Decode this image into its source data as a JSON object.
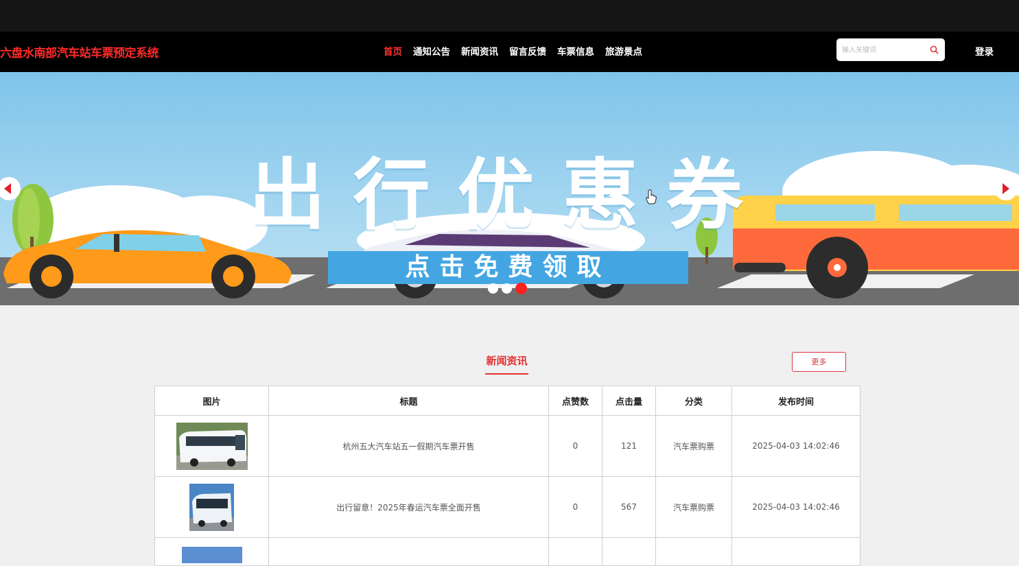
{
  "header": {
    "brand": "六盘水南部汽车站车票预定系统",
    "nav": [
      {
        "label": "首页",
        "active": true
      },
      {
        "label": "通知公告",
        "active": false
      },
      {
        "label": "新闻资讯",
        "active": false
      },
      {
        "label": "留言反馈",
        "active": false
      },
      {
        "label": "车票信息",
        "active": false
      },
      {
        "label": "旅游景点",
        "active": false
      }
    ],
    "search_placeholder": "输入关键词",
    "login_label": "登录"
  },
  "banner": {
    "title": "出行优惠券",
    "cta": "点击免费领取",
    "slide_count": 3,
    "active_slide": 3
  },
  "news": {
    "section_title": "新闻资讯",
    "more_label": "更多",
    "columns": [
      "图片",
      "标题",
      "点赞数",
      "点击量",
      "分类",
      "发布时间"
    ],
    "rows": [
      {
        "title": "杭州五大汽车站五一假期汽车票开售",
        "likes": "0",
        "clicks": "121",
        "category": "汽车票购票",
        "date": "2025-04-03 14:02:46"
      },
      {
        "title": "出行留意！2025年春运汽车票全面开售",
        "likes": "0",
        "clicks": "567",
        "category": "汽车票购票",
        "date": "2025-04-03 14:02:46"
      }
    ]
  },
  "colors": {
    "accent": "#ff2a2a",
    "nav_bg": "#000000",
    "page_bg": "#f0f0f0"
  }
}
